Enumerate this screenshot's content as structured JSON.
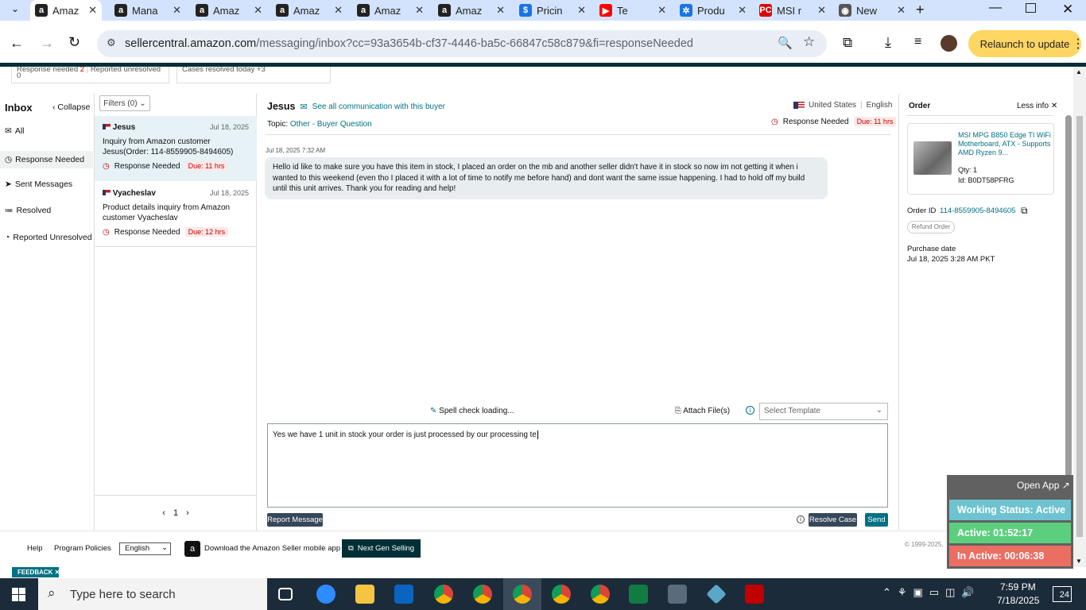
{
  "browser": {
    "tabs": [
      {
        "label": "Amaz",
        "icon": "amazon-icon",
        "active": true
      },
      {
        "label": "Mana",
        "icon": "amazon-icon"
      },
      {
        "label": "Amaz",
        "icon": "amazon-icon"
      },
      {
        "label": "Amaz",
        "icon": "amazon-icon"
      },
      {
        "label": "Amaz",
        "icon": "amazon-icon"
      },
      {
        "label": "Amaz",
        "icon": "amazon-icon"
      },
      {
        "label": "Pricin",
        "icon": "dollar-icon"
      },
      {
        "label": "Te",
        "icon": "youtube-icon"
      },
      {
        "label": "Produ",
        "icon": "produ-icon"
      },
      {
        "label": "MSI r",
        "icon": "pc-icon"
      },
      {
        "label": "New",
        "icon": "chrome-icon"
      }
    ],
    "url_domain": "sellercentral.amazon.com",
    "url_rest": "/messaging/inbox?cc=93a3654b-cf37-4446-ba5c-66847c58c879&fi=responseNeeded",
    "relaunch_label": "Relaunch to update"
  },
  "stats": {
    "response_needed_label": "Response needed",
    "response_needed_count": "2",
    "reported_unresolved_label": "Reported unresolved",
    "reported_unresolved_count": "0",
    "cases_resolved_label": "Cases resolved today",
    "cases_resolved_count": "+3"
  },
  "nav": {
    "title": "Inbox",
    "collapse": "Collapse",
    "items": [
      "All",
      "Response Needed",
      "Sent Messages",
      "Resolved",
      "Reported Unresolved"
    ]
  },
  "list": {
    "filters": "Filters (0)",
    "conversations": [
      {
        "name": "Jesus",
        "date": "Jul 18, 2025",
        "subject": "Inquiry from Amazon customer Jesus(Order: 114-8559905-8494605)",
        "status": "Response Needed",
        "due": "Due: 11 hrs"
      },
      {
        "name": "Vyacheslav",
        "date": "Jul 18, 2025",
        "subject": "Product details inquiry from Amazon customer Vyacheslav",
        "status": "Response Needed",
        "due": "Due: 12 hrs"
      }
    ],
    "page": "1"
  },
  "thread": {
    "buyer": "Jesus",
    "see_all": "See all communication with this buyer",
    "country": "United States",
    "language": "English",
    "topic_label": "Topic:",
    "topic": "Other - Buyer Question",
    "status": "Response Needed",
    "due": "Due: 11 hrs",
    "timestamp": "Jul 18, 2025 7:32 AM",
    "message": "Hello id like to make sure you have this item in stock, I placed an order on the mb and another seller didn't have it in stock so now im not getting it when i wanted to this weekend (even tho I placed it with a lot of time to notify me before hand) and dont want the same issue happening. I had to hold off my build until this unit arrives. Thank you for reading and help!",
    "spell_check": "Spell check loading...",
    "attach": "Attach File(s)",
    "template_placeholder": "Select Template",
    "reply_text": "Yes we have 1 unit in stock your order is just processed by our processing te",
    "report": "Report Message",
    "resolve": "Resolve Case",
    "send": "Send"
  },
  "order": {
    "title": "Order",
    "less_info": "Less info",
    "product_title": "MSI MPG B850 Edge TI WiFi Motherboard, ATX - Supports AMD Ryzen 9...",
    "qty": "Qty: 1",
    "asin": "Id: B0DT58PFRG",
    "order_id_label": "Order ID",
    "order_id": "114-8559905-8494605",
    "refund": "Refund Order",
    "purchase_date_label": "Purchase date",
    "purchase_date": "Jul 18, 2025 3:28 AM PKT"
  },
  "footer": {
    "help": "Help",
    "policies": "Program Policies",
    "language": "English",
    "app": "Download the Amazon Seller mobile app",
    "next_gen": "Next Gen Selling",
    "copyright": "© 1999-2025,",
    "feedback": "FEEDBACK"
  },
  "widget": {
    "open_app": "Open App",
    "working_status": "Working Status: Active",
    "active": "Active: 01:52:17",
    "inactive": "In Active: 00:06:38",
    "colors": {
      "status": "#6ec3d0",
      "active": "#5ccf7f",
      "inactive": "#eb6e63"
    }
  },
  "taskbar": {
    "search_placeholder": "Type here to search",
    "time": "7:59 PM",
    "date": "7/18/2025",
    "notifications": "24"
  }
}
